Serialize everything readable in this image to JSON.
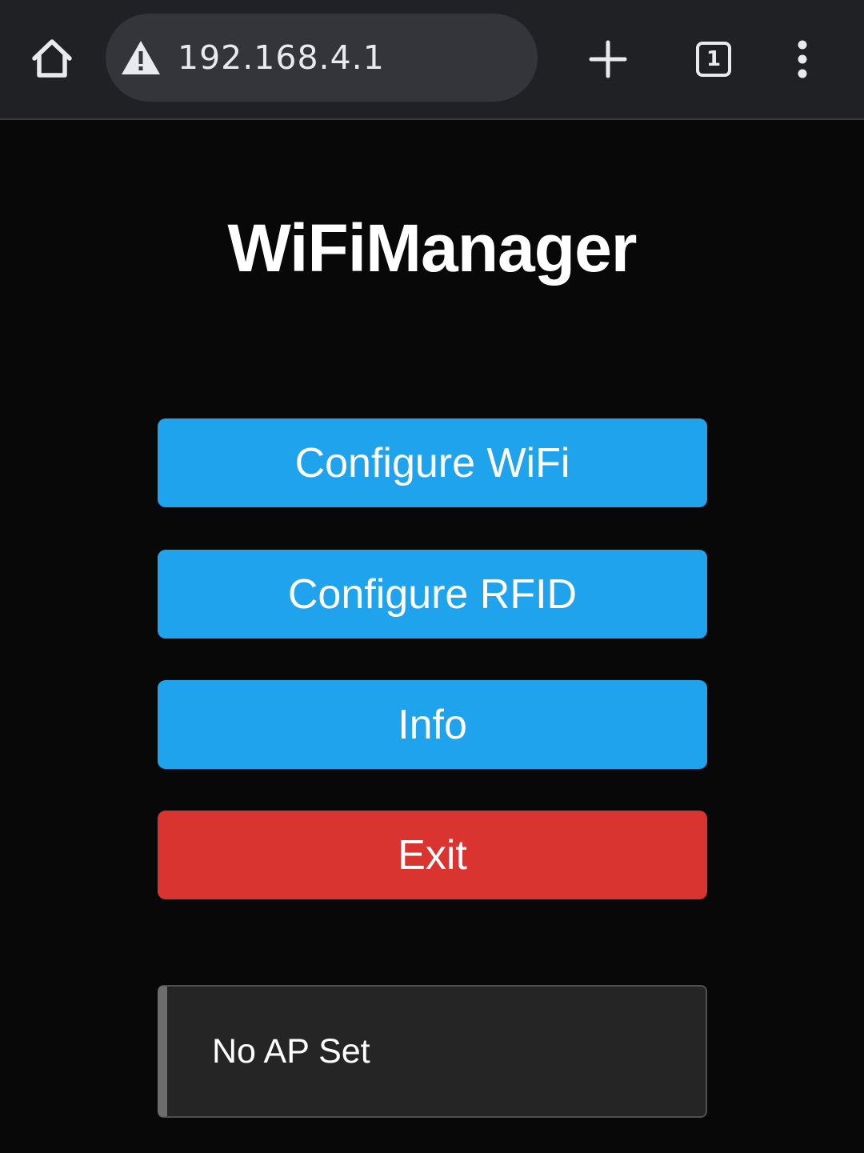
{
  "browser": {
    "url": "192.168.4.1",
    "tab_count": "1",
    "icons": {
      "home": "home-icon",
      "security": "warning-triangle-icon",
      "new_tab": "plus-icon",
      "tabs": "tab-switcher-icon",
      "menu": "more-vert-icon"
    }
  },
  "page": {
    "title": "WiFiManager",
    "buttons": [
      {
        "label": "Configure WiFi",
        "color": "#1fa3ec"
      },
      {
        "label": "Configure RFID",
        "color": "#1fa3ec"
      },
      {
        "label": "Info",
        "color": "#1fa3ec"
      },
      {
        "label": "Exit",
        "color": "#d9342f"
      }
    ],
    "status": "No AP Set"
  }
}
